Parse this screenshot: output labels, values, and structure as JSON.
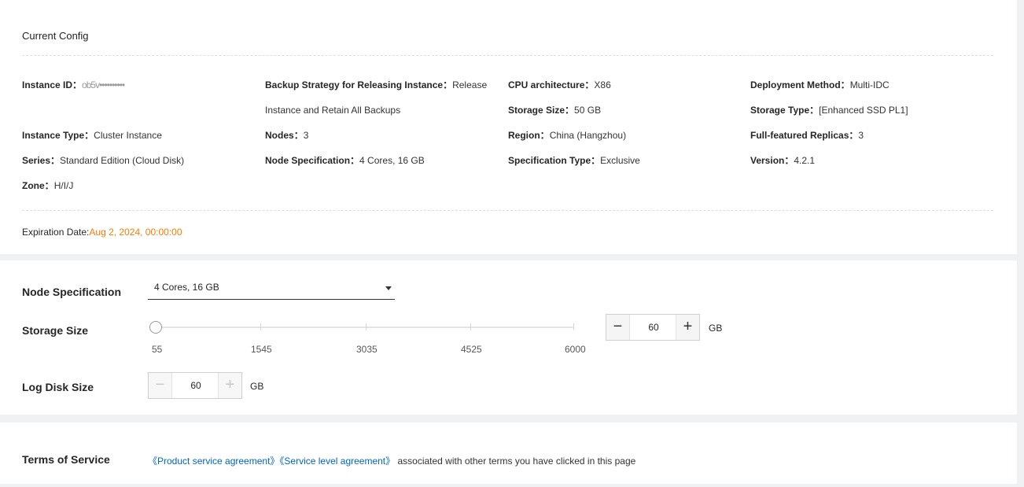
{
  "current_config": {
    "title": "Current Config",
    "items": [
      {
        "label": "Instance ID",
        "value": "ob5v••••••••••"
      },
      {
        "label": "Backup Strategy for Releasing Instance",
        "value": "Release",
        "value_line2": "Instance and Retain All Backups"
      },
      {
        "label": "CPU architecture",
        "value": "X86"
      },
      {
        "label": "Deployment Method",
        "value": "Multi-IDC"
      },
      {
        "label": "Storage Size",
        "value": "50 GB"
      },
      {
        "label": "Storage Type",
        "value": "[Enhanced SSD PL1]"
      },
      {
        "label": "Instance Type",
        "value": "Cluster Instance"
      },
      {
        "label": "Nodes",
        "value": "3"
      },
      {
        "label": "Region",
        "value": "China (Hangzhou)"
      },
      {
        "label": "Full-featured Replicas",
        "value": "3"
      },
      {
        "label": "Series",
        "value": "Standard Edition (Cloud Disk)"
      },
      {
        "label": "Node Specification",
        "value": "4 Cores, 16 GB"
      },
      {
        "label": "Specification Type",
        "value": "Exclusive"
      },
      {
        "label": "Version",
        "value": "4.2.1"
      },
      {
        "label": "Zone",
        "value": "H/I/J"
      }
    ],
    "separator": "：",
    "expiration_label": "Expiration Date:",
    "expiration_value": "Aug 2, 2024, 00:00:00",
    "expiration_color": "#ff7a00"
  },
  "form": {
    "node_spec": {
      "label": "Node Specification",
      "value": "4 Cores, 16 GB"
    },
    "storage": {
      "label": "Storage Size",
      "marks": [
        "55",
        "1545",
        "3035",
        "4525",
        "6000"
      ],
      "min": 55,
      "max": 6000,
      "current": 55,
      "value": "60",
      "minus": "−",
      "plus": "+",
      "unit": "GB"
    },
    "log_disk": {
      "label": "Log Disk Size",
      "value": "60",
      "minus": "−",
      "plus": "+",
      "unit": "GB"
    }
  },
  "terms": {
    "label": "Terms of Service",
    "link1": "《Product service agreement》",
    "link2": "《Service level agreement》",
    "text": " associated with other terms you have clicked in this page",
    "link_color": "#0064c8"
  }
}
